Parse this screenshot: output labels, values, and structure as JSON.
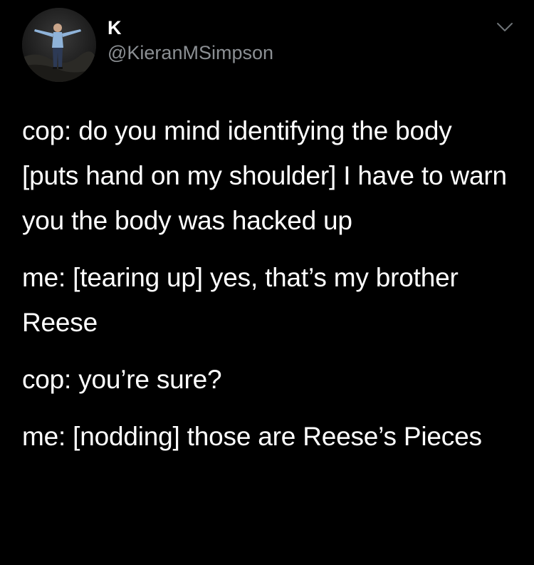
{
  "author": {
    "display_name": "K",
    "handle": "@KieranMSimpson"
  },
  "menu": {
    "icon": "chevron-down-icon"
  },
  "tweet": {
    "paragraphs": [
      "cop: do you mind identifying the body [puts hand on my shoulder] I have to warn you the body was hacked up",
      "me: [tearing up] yes, that’s my brother Reese",
      "cop: you’re sure?",
      "me: [nodding] those are Reese’s Pieces"
    ]
  },
  "colors": {
    "background": "#000000",
    "text": "#ffffff",
    "secondary_text": "#8b8f93"
  }
}
